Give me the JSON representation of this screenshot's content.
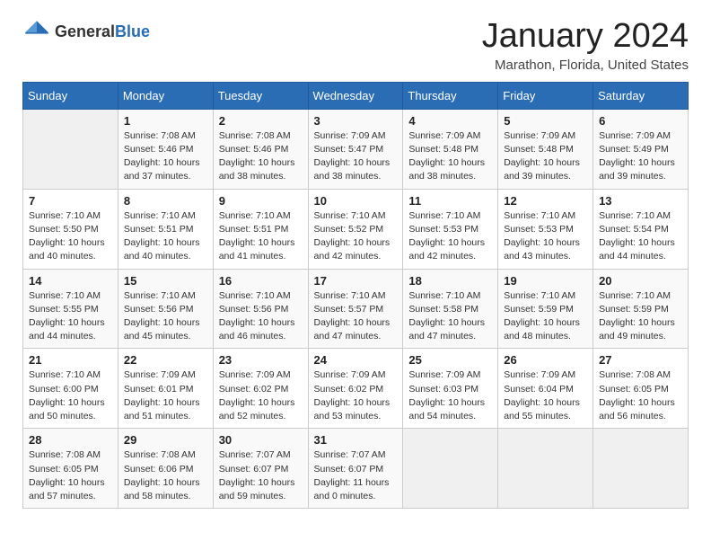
{
  "header": {
    "logo_general": "General",
    "logo_blue": "Blue",
    "month_title": "January 2024",
    "location": "Marathon, Florida, United States"
  },
  "weekdays": [
    "Sunday",
    "Monday",
    "Tuesday",
    "Wednesday",
    "Thursday",
    "Friday",
    "Saturday"
  ],
  "weeks": [
    [
      {
        "day": "",
        "info": ""
      },
      {
        "day": "1",
        "info": "Sunrise: 7:08 AM\nSunset: 5:46 PM\nDaylight: 10 hours\nand 37 minutes."
      },
      {
        "day": "2",
        "info": "Sunrise: 7:08 AM\nSunset: 5:46 PM\nDaylight: 10 hours\nand 38 minutes."
      },
      {
        "day": "3",
        "info": "Sunrise: 7:09 AM\nSunset: 5:47 PM\nDaylight: 10 hours\nand 38 minutes."
      },
      {
        "day": "4",
        "info": "Sunrise: 7:09 AM\nSunset: 5:48 PM\nDaylight: 10 hours\nand 38 minutes."
      },
      {
        "day": "5",
        "info": "Sunrise: 7:09 AM\nSunset: 5:48 PM\nDaylight: 10 hours\nand 39 minutes."
      },
      {
        "day": "6",
        "info": "Sunrise: 7:09 AM\nSunset: 5:49 PM\nDaylight: 10 hours\nand 39 minutes."
      }
    ],
    [
      {
        "day": "7",
        "info": "Sunrise: 7:10 AM\nSunset: 5:50 PM\nDaylight: 10 hours\nand 40 minutes."
      },
      {
        "day": "8",
        "info": "Sunrise: 7:10 AM\nSunset: 5:51 PM\nDaylight: 10 hours\nand 40 minutes."
      },
      {
        "day": "9",
        "info": "Sunrise: 7:10 AM\nSunset: 5:51 PM\nDaylight: 10 hours\nand 41 minutes."
      },
      {
        "day": "10",
        "info": "Sunrise: 7:10 AM\nSunset: 5:52 PM\nDaylight: 10 hours\nand 42 minutes."
      },
      {
        "day": "11",
        "info": "Sunrise: 7:10 AM\nSunset: 5:53 PM\nDaylight: 10 hours\nand 42 minutes."
      },
      {
        "day": "12",
        "info": "Sunrise: 7:10 AM\nSunset: 5:53 PM\nDaylight: 10 hours\nand 43 minutes."
      },
      {
        "day": "13",
        "info": "Sunrise: 7:10 AM\nSunset: 5:54 PM\nDaylight: 10 hours\nand 44 minutes."
      }
    ],
    [
      {
        "day": "14",
        "info": "Sunrise: 7:10 AM\nSunset: 5:55 PM\nDaylight: 10 hours\nand 44 minutes."
      },
      {
        "day": "15",
        "info": "Sunrise: 7:10 AM\nSunset: 5:56 PM\nDaylight: 10 hours\nand 45 minutes."
      },
      {
        "day": "16",
        "info": "Sunrise: 7:10 AM\nSunset: 5:56 PM\nDaylight: 10 hours\nand 46 minutes."
      },
      {
        "day": "17",
        "info": "Sunrise: 7:10 AM\nSunset: 5:57 PM\nDaylight: 10 hours\nand 47 minutes."
      },
      {
        "day": "18",
        "info": "Sunrise: 7:10 AM\nSunset: 5:58 PM\nDaylight: 10 hours\nand 47 minutes."
      },
      {
        "day": "19",
        "info": "Sunrise: 7:10 AM\nSunset: 5:59 PM\nDaylight: 10 hours\nand 48 minutes."
      },
      {
        "day": "20",
        "info": "Sunrise: 7:10 AM\nSunset: 5:59 PM\nDaylight: 10 hours\nand 49 minutes."
      }
    ],
    [
      {
        "day": "21",
        "info": "Sunrise: 7:10 AM\nSunset: 6:00 PM\nDaylight: 10 hours\nand 50 minutes."
      },
      {
        "day": "22",
        "info": "Sunrise: 7:09 AM\nSunset: 6:01 PM\nDaylight: 10 hours\nand 51 minutes."
      },
      {
        "day": "23",
        "info": "Sunrise: 7:09 AM\nSunset: 6:02 PM\nDaylight: 10 hours\nand 52 minutes."
      },
      {
        "day": "24",
        "info": "Sunrise: 7:09 AM\nSunset: 6:02 PM\nDaylight: 10 hours\nand 53 minutes."
      },
      {
        "day": "25",
        "info": "Sunrise: 7:09 AM\nSunset: 6:03 PM\nDaylight: 10 hours\nand 54 minutes."
      },
      {
        "day": "26",
        "info": "Sunrise: 7:09 AM\nSunset: 6:04 PM\nDaylight: 10 hours\nand 55 minutes."
      },
      {
        "day": "27",
        "info": "Sunrise: 7:08 AM\nSunset: 6:05 PM\nDaylight: 10 hours\nand 56 minutes."
      }
    ],
    [
      {
        "day": "28",
        "info": "Sunrise: 7:08 AM\nSunset: 6:05 PM\nDaylight: 10 hours\nand 57 minutes."
      },
      {
        "day": "29",
        "info": "Sunrise: 7:08 AM\nSunset: 6:06 PM\nDaylight: 10 hours\nand 58 minutes."
      },
      {
        "day": "30",
        "info": "Sunrise: 7:07 AM\nSunset: 6:07 PM\nDaylight: 10 hours\nand 59 minutes."
      },
      {
        "day": "31",
        "info": "Sunrise: 7:07 AM\nSunset: 6:07 PM\nDaylight: 11 hours\nand 0 minutes."
      },
      {
        "day": "",
        "info": ""
      },
      {
        "day": "",
        "info": ""
      },
      {
        "day": "",
        "info": ""
      }
    ]
  ]
}
